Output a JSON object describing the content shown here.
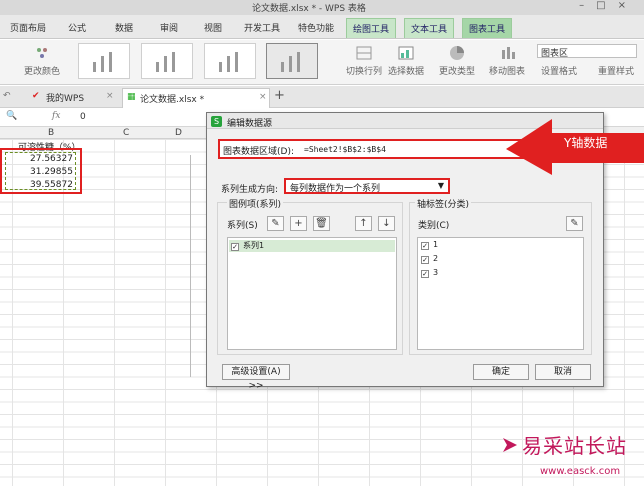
{
  "window": {
    "title": "论文数据.xlsx * - WPS 表格"
  },
  "ribbon_tabs": [
    "页面布局",
    "公式",
    "数据",
    "审阅",
    "视图",
    "开发工具",
    "特色功能",
    "绘图工具",
    "文本工具",
    "图表工具"
  ],
  "ribbon": {
    "change_color": "更改颜色",
    "switch_rowcol": "切换行列",
    "select_data": "选择数据",
    "change_type": "更改类型",
    "move_chart": "移动图表",
    "chart_area_select": "图表区",
    "set_format": "设置格式",
    "reset_style": "重置样式"
  },
  "doc_tabs": {
    "home": "我的WPS",
    "file": "论文数据.xlsx *"
  },
  "formula_bar": {
    "fx": "fx",
    "value": "0"
  },
  "columns": [
    "B",
    "C",
    "D"
  ],
  "sheet": {
    "header": "可溶性糖（%）",
    "values": [
      "27.56327",
      "31.29855",
      "39.55872"
    ]
  },
  "dialog": {
    "title": "编辑数据源",
    "range_label": "图表数据区域(D):",
    "range_value": "=Sheet2!$B$2:$B$4",
    "direction_label": "系列生成方向:",
    "direction_value": "每列数据作为一个系列",
    "legend_group": "图例项(系列)",
    "series_label": "系列(S)",
    "series_items": [
      "系列1"
    ],
    "axis_group": "轴标签(分类)",
    "category_label": "类别(C)",
    "category_items": [
      "1",
      "2",
      "3"
    ],
    "advanced_button": "高级设置(A) >>",
    "ok_button": "确定",
    "cancel_button": "取消"
  },
  "annotation": {
    "text": "Y轴数据",
    "color": "#e02020"
  },
  "watermark": {
    "line1": "易采站长站",
    "line2": "www.easck.com"
  }
}
